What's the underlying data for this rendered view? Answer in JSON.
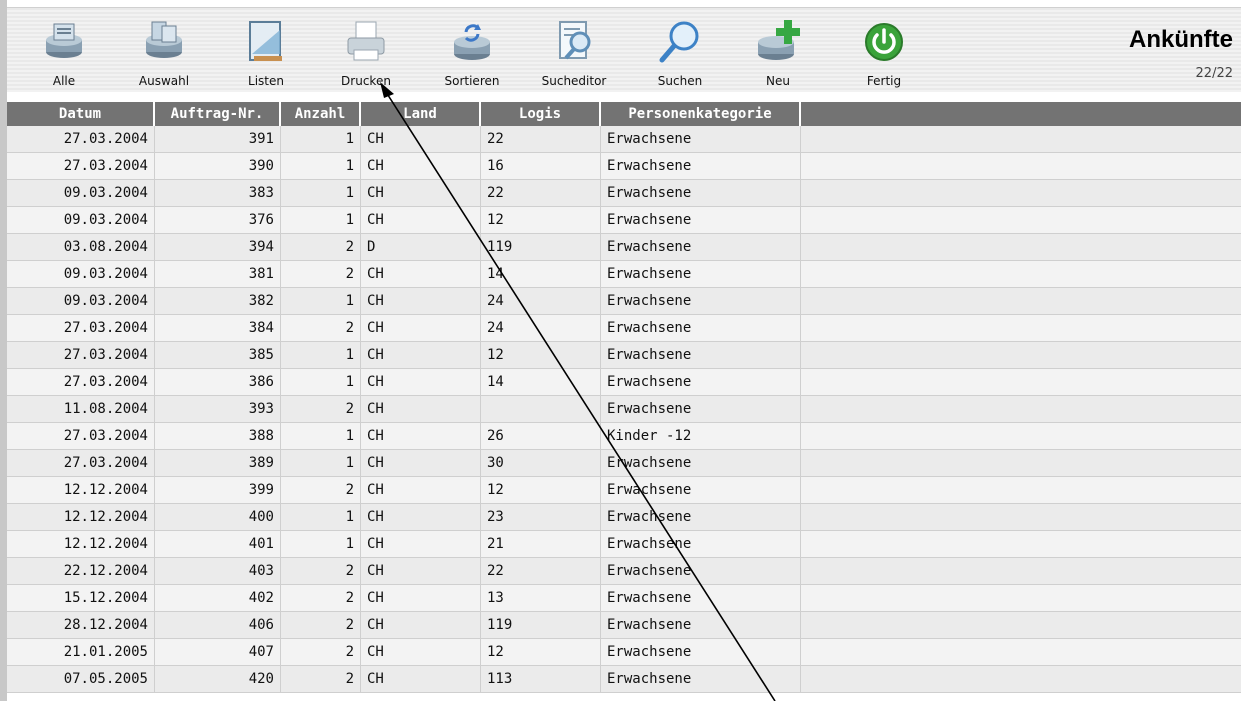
{
  "toolbar": {
    "buttons": [
      {
        "label": "Alle",
        "icon": "database-icon"
      },
      {
        "label": "Auswahl",
        "icon": "database-selection-icon"
      },
      {
        "label": "Listen",
        "icon": "list-ruler-icon"
      },
      {
        "label": "Drucken",
        "icon": "printer-icon"
      },
      {
        "label": "Sortieren",
        "icon": "sort-icon"
      },
      {
        "label": "Sucheditor",
        "icon": "search-editor-icon"
      },
      {
        "label": "Suchen",
        "icon": "magnifier-icon"
      },
      {
        "label": "Neu",
        "icon": "new-record-icon"
      },
      {
        "label": "Fertig",
        "icon": "power-icon"
      }
    ]
  },
  "window": {
    "title": "Ankünfte",
    "record_count": "22/22"
  },
  "table": {
    "headers": [
      "Datum",
      "Auftrag-Nr.",
      "Anzahl",
      "Land",
      "Logis",
      "Personenkategorie",
      ""
    ],
    "rows": [
      [
        "27.03.2004",
        "391",
        "1",
        "CH",
        "22",
        "Erwachsene"
      ],
      [
        "27.03.2004",
        "390",
        "1",
        "CH",
        "16",
        "Erwachsene"
      ],
      [
        "09.03.2004",
        "383",
        "1",
        "CH",
        "22",
        "Erwachsene"
      ],
      [
        "09.03.2004",
        "376",
        "1",
        "CH",
        "12",
        "Erwachsene"
      ],
      [
        "03.08.2004",
        "394",
        "2",
        "D",
        "119",
        "Erwachsene"
      ],
      [
        "09.03.2004",
        "381",
        "2",
        "CH",
        "14",
        "Erwachsene"
      ],
      [
        "09.03.2004",
        "382",
        "1",
        "CH",
        "24",
        "Erwachsene"
      ],
      [
        "27.03.2004",
        "384",
        "2",
        "CH",
        "24",
        "Erwachsene"
      ],
      [
        "27.03.2004",
        "385",
        "1",
        "CH",
        "12",
        "Erwachsene"
      ],
      [
        "27.03.2004",
        "386",
        "1",
        "CH",
        "14",
        "Erwachsene"
      ],
      [
        "11.08.2004",
        "393",
        "2",
        "CH",
        "",
        "Erwachsene"
      ],
      [
        "27.03.2004",
        "388",
        "1",
        "CH",
        "26",
        "Kinder -12"
      ],
      [
        "27.03.2004",
        "389",
        "1",
        "CH",
        "30",
        "Erwachsene"
      ],
      [
        "12.12.2004",
        "399",
        "2",
        "CH",
        "12",
        "Erwachsene"
      ],
      [
        "12.12.2004",
        "400",
        "1",
        "CH",
        "23",
        "Erwachsene"
      ],
      [
        "12.12.2004",
        "401",
        "1",
        "CH",
        "21",
        "Erwachsene"
      ],
      [
        "22.12.2004",
        "403",
        "2",
        "CH",
        "22",
        "Erwachsene"
      ],
      [
        "15.12.2004",
        "402",
        "2",
        "CH",
        "13",
        "Erwachsene"
      ],
      [
        "28.12.2004",
        "406",
        "2",
        "CH",
        "119",
        "Erwachsene"
      ],
      [
        "21.01.2005",
        "407",
        "2",
        "CH",
        "12",
        "Erwachsene"
      ],
      [
        "07.05.2005",
        "420",
        "2",
        "CH",
        "113",
        "Erwachsene"
      ]
    ]
  },
  "colors": {
    "header_bg": "#737373",
    "accent_green": "#3aa33a",
    "accent_blue": "#4a7fc1"
  }
}
